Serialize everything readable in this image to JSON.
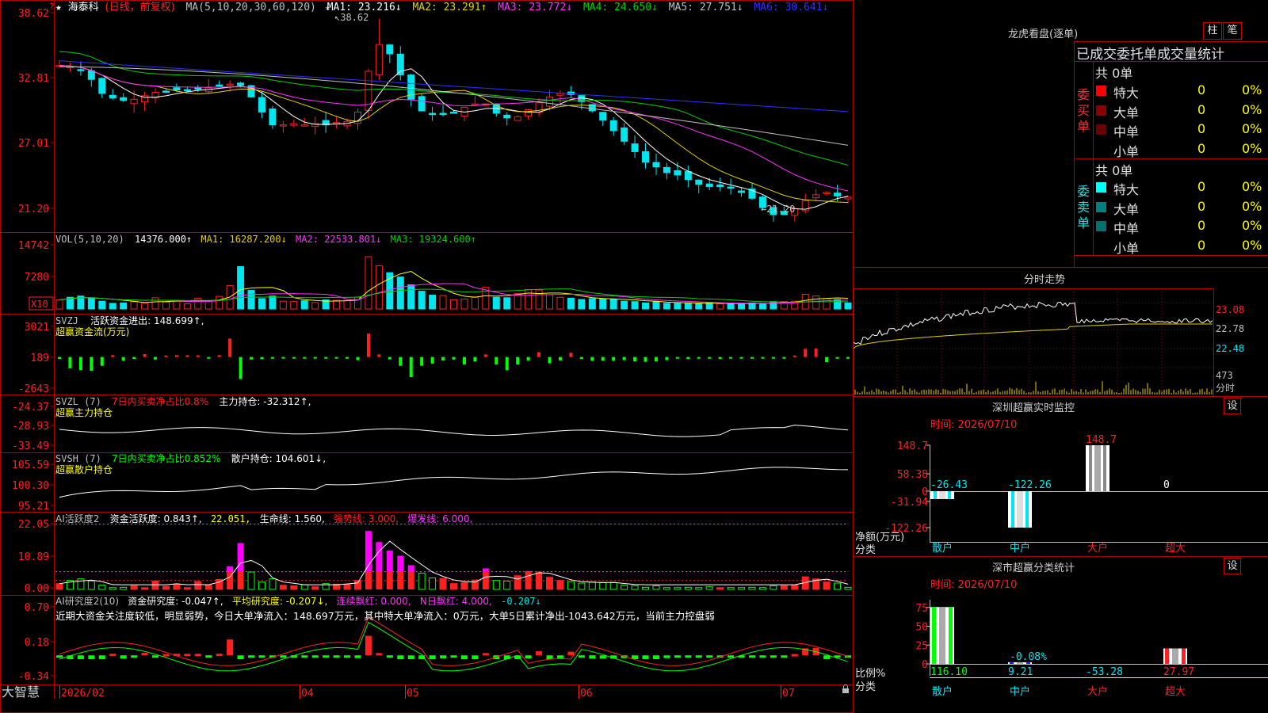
{
  "colors": {
    "up": "#ff2020",
    "down": "#00e5ee",
    "bg": "#000000",
    "border": "#b00000",
    "ma1": "#ffffff",
    "ma2": "#e8d000",
    "ma3": "#ff30ff",
    "ma4": "#00d000",
    "ma5": "#c0c0c0",
    "ma6": "#3030ff",
    "yellow": "#ffff00",
    "green": "#00ff00",
    "magenta": "#ff00ff"
  },
  "price_panel": {
    "star": "★",
    "name": "海泰科",
    "mode": "(日线，前复权)",
    "ma_label": "MA(5,10,20,30,60,120)",
    "ma1": "MA1: 23.216↓",
    "ma2": "MA2: 23.291↑",
    "ma3": "MA3: 23.772↓",
    "ma4": "MA4: 24.650↓",
    "ma5": "MA5: 27.751↓",
    "ma6": "MA6: 30.641↓",
    "ticks": [
      "38.62",
      "32.81",
      "27.01",
      "21.20"
    ],
    "high_note": "38.62",
    "low_note": "21.20",
    "ylim": [
      20.5,
      39.2
    ]
  },
  "vol_panel": {
    "label": "VOL(5,10,20)",
    "vol": "14376.000↑",
    "ma1": "MA1: 16287.200↓",
    "ma2": "MA2: 22533.801↓",
    "ma3": "MA3: 19324.600↑",
    "ticks": [
      "14742",
      "7280"
    ],
    "unit": "X10",
    "ymax": 16500
  },
  "svzj": {
    "label": "SVZJ",
    "desc": "活跃资金进出: 148.699↑,",
    "sub": "超赢资金流(万元)",
    "ticks": [
      "3021",
      "189",
      "-2643"
    ],
    "ylim": [
      -2800,
      3200
    ]
  },
  "svzl": {
    "label": "SVZL (7)",
    "desc": "7日内买卖净占比0.8%",
    "hold": "主力持仓: -32.312↑,",
    "sub": "超赢主力持仓",
    "ticks": [
      "-24.37",
      "-28.93",
      "-33.49"
    ],
    "ylim": [
      -34,
      -23.8
    ]
  },
  "svsh": {
    "label": "SVSH (7)",
    "desc": "7日内买卖净占比0.852%",
    "hold": "散户持仓: 104.601↓,",
    "sub": "超赢散户持仓",
    "ticks": [
      "105.59",
      "100.30",
      "95.21"
    ],
    "ylim": [
      94.6,
      106.2
    ]
  },
  "ai_act": {
    "label": "AI活跃度2",
    "v1": "资金活跃度: 0.843↑,",
    "v2": "22.051,",
    "v3": "生命线: 1.560,",
    "v4": "强势线: 3.000,",
    "v5": "爆发线: 6.000,",
    "ticks": [
      "22.05",
      "10.89",
      "0.00"
    ],
    "ymax": 23
  },
  "ai_res": {
    "label": "AI研究度2(10)",
    "v1": "资金研究度: -0.047↑,",
    "v2": "平均研究度: -0.207↓,",
    "v3": "连续飘红: 0.000,",
    "v4": "N日飘红: 4.000,",
    "v5": "-0.207↓",
    "comment": "近期大资金关注度较低，明显弱势，今日大单净流入：148.697万元，其中特大单净流入：0万元，大单5日累计净出-1043.642万元，当前主力控盘弱",
    "ticks": [
      "0.70",
      "0.18",
      "-0.34"
    ],
    "ylim": [
      -0.4,
      0.76
    ]
  },
  "xaxis": {
    "brand": "大智慧",
    "labels": [
      "2026/02",
      "04",
      "05",
      "06",
      "07"
    ]
  },
  "right": {
    "lhb_title": "龙虎看盘(逐单)",
    "btn_col": "柱",
    "btn_pen": "笔",
    "stat_title": "已成交委托单成交量统计",
    "buy": {
      "title_chars": [
        "委",
        "买",
        "单"
      ],
      "total": "共 0单",
      "rows": [
        {
          "name": "特大",
          "val": "0",
          "pct": "0%",
          "color": "#ff0000"
        },
        {
          "name": "大单",
          "val": "0",
          "pct": "0%",
          "color": "#8a0000"
        },
        {
          "name": "中单",
          "val": "0",
          "pct": "0%",
          "color": "#6a0000"
        },
        {
          "name": "小单",
          "val": "0",
          "pct": "0%",
          "color": ""
        }
      ]
    },
    "sell": {
      "title_chars": [
        "委",
        "卖",
        "单"
      ],
      "total": "共 0单",
      "rows": [
        {
          "name": "特大",
          "val": "0",
          "pct": "0%",
          "color": "#00ffff"
        },
        {
          "name": "大单",
          "val": "0",
          "pct": "0%",
          "color": "#008080"
        },
        {
          "name": "中单",
          "val": "0",
          "pct": "0%",
          "color": "#007070"
        },
        {
          "name": "小单",
          "val": "0",
          "pct": "0%",
          "color": ""
        }
      ]
    },
    "intraday_title": "分时走势",
    "intraday_ticks": [
      "23.08",
      "22.78",
      "22.48"
    ],
    "intraday_vol": "473",
    "intraday_unit": "分时",
    "monitor_title": "深圳超赢实时监控",
    "set": "设",
    "monitor_time": "时间: 2026/07/10",
    "monitor_ticks": [
      "148.7",
      "58.38",
      "0",
      "-31.94",
      "-122.26"
    ],
    "monitor_ylabel": "净额(万元)",
    "monitor_xlabel": "分类",
    "monitor_data": {
      "type": "bar",
      "categories": [
        "散户",
        "中户",
        "大户",
        "超大"
      ],
      "values": [
        -26.43,
        -122.26,
        148.7,
        0
      ],
      "labels": [
        "-26.43",
        "-122.26",
        "148.7",
        "0"
      ],
      "ylim": [
        -122.26,
        148.7
      ]
    },
    "class_title": "深市超赢分类统计",
    "class_time": "时间: 2026/07/10",
    "class_ticks": [
      "75",
      "50",
      "25",
      "0"
    ],
    "class_ylabel": "比例%",
    "class_xlabel": "分类",
    "class_data": {
      "type": "bar",
      "categories": [
        "散户",
        "中户",
        "大户",
        "超大"
      ],
      "bars": [
        75.5,
        2.2,
        0,
        20.5
      ],
      "values": [
        "116.10",
        "9.21",
        "-53.28",
        "27.97"
      ],
      "pct": [
        "",
        "-0.08%",
        "",
        ""
      ],
      "ylim": [
        0,
        80
      ]
    }
  },
  "chart_data": [
    {
      "type": "line",
      "title": "海泰科 (日线，前复权)",
      "series": [
        {
          "name": "MA1",
          "values": [
            34.6,
            34.5,
            34.2,
            33.4,
            32.2,
            31.8,
            31.6,
            31.7,
            32.0,
            32.3,
            32.4,
            32.5,
            32.5,
            32.6,
            32.7,
            32.9,
            33.0,
            32.9,
            31.9,
            30.6,
            29.5,
            29.5,
            29.6,
            29.5,
            29.6,
            29.5,
            29.7,
            29.8,
            30.6,
            34.1,
            36.4,
            35.6,
            33.8,
            31.7,
            30.7,
            30.4,
            30.4,
            30.5,
            31.0,
            31.3,
            31.3,
            30.5,
            30.1,
            30.2,
            30.8,
            31.4,
            31.9,
            32.2,
            32.1,
            31.5,
            30.7,
            29.9,
            29.0,
            28.1,
            27.2,
            26.3,
            25.9,
            25.4,
            25.2,
            24.8,
            24.4,
            24.2,
            24.2,
            24.1,
            23.7,
            23.2,
            22.4,
            21.8,
            21.8,
            22.3,
            23.0,
            23.5,
            23.7,
            23.4,
            23.3
          ]
        }
      ]
    },
    {
      "type": "bar",
      "title": "VOL(5,10,20)",
      "values": [
        2100,
        2700,
        3000,
        2600,
        1800,
        1300,
        1400,
        1700,
        1300,
        2600,
        1600,
        2000,
        1200,
        2500,
        1800,
        2900,
        5400,
        9800,
        4300,
        2400,
        3000,
        1800,
        1700,
        1900,
        1500,
        2100,
        2000,
        2000,
        2700,
        12100,
        10000,
        8400,
        7400,
        5600,
        4100,
        3200,
        3100,
        2100,
        2300,
        2800,
        5000,
        2700,
        2600,
        3600,
        4500,
        4400,
        3300,
        2700,
        2500,
        2200,
        2400,
        2300,
        2300,
        1800,
        1700,
        1400,
        1700,
        1300,
        1300,
        1400,
        1200,
        1500,
        1200,
        1100,
        1200,
        1400,
        1300,
        1700,
        1700,
        1800,
        3400,
        3000,
        2400,
        2200,
        1400
      ]
    },
    {
      "type": "bar",
      "title": "SVZJ",
      "values": [
        -150,
        -900,
        -1050,
        -1100,
        -700,
        150,
        -300,
        -150,
        230,
        -200,
        120,
        150,
        140,
        140,
        -100,
        150,
        1470,
        -1750,
        -200,
        -180,
        -100,
        -120,
        -100,
        -100,
        -100,
        -100,
        -110,
        -130,
        -250,
        1870,
        210,
        -190,
        -700,
        -1600,
        -700,
        -520,
        -270,
        -200,
        -600,
        -360,
        210,
        -600,
        -1050,
        -600,
        -280,
        380,
        -500,
        -270,
        340,
        -150,
        -300,
        -300,
        -300,
        -250,
        -350,
        -380,
        -350,
        -250,
        -100,
        -160,
        -130,
        -100,
        -160,
        -110,
        -120,
        -130,
        -110,
        -110,
        -100,
        120,
        650,
        680,
        -400,
        -130,
        -130
      ]
    }
  ]
}
